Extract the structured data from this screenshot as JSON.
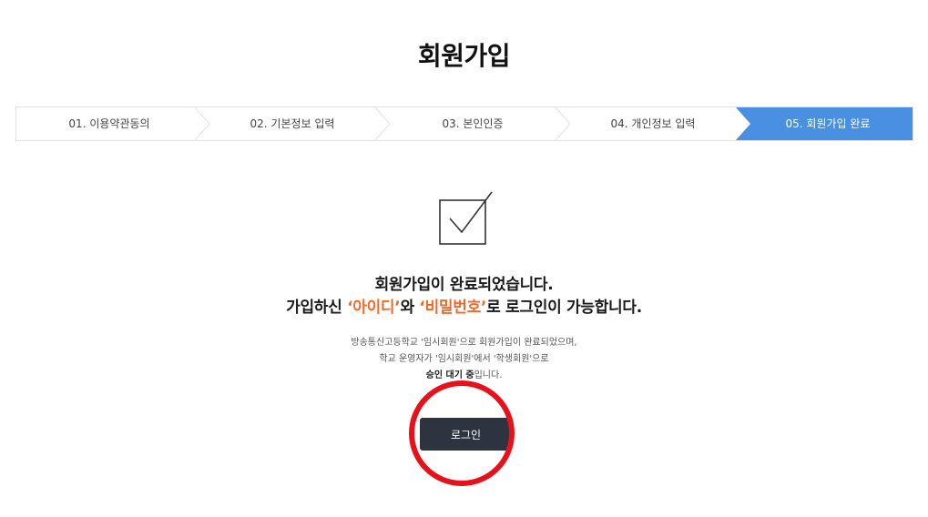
{
  "page": {
    "title": "회원가입"
  },
  "steps": [
    {
      "label": "01. 이용약관동의",
      "active": false
    },
    {
      "label": "02. 기본정보 입력",
      "active": false
    },
    {
      "label": "03. 본인인증",
      "active": false
    },
    {
      "label": "04. 개인정보 입력",
      "active": false
    },
    {
      "label": "05. 회원가입 완료",
      "active": true
    }
  ],
  "colors": {
    "step_active_bg": "#4a90e2",
    "step_border": "#e2e2e2",
    "highlight": "#f26a2a",
    "button_bg": "#2d3440",
    "annotation_circle": "#e8101a"
  },
  "result": {
    "icon": "checkbox-check-icon",
    "line1": "회원가입이 완료되었습니다.",
    "line2_prefix": "가입하신 ",
    "line2_id": "‘아이디’",
    "line2_and": "와 ",
    "line2_pw": "‘비밀번호’",
    "line2_suffix": "로 로그인이 가능합니다."
  },
  "notice": {
    "line1": "방송통신고등학교 '임시회원'으로 회원가입이 완료되었으며,",
    "line2": "학교 운영자가 '임시회원'에서 '학생회원'으로",
    "line3_bold": "승인 대기 중",
    "line3_rest": "입니다."
  },
  "login_button": {
    "label": "로그인"
  }
}
